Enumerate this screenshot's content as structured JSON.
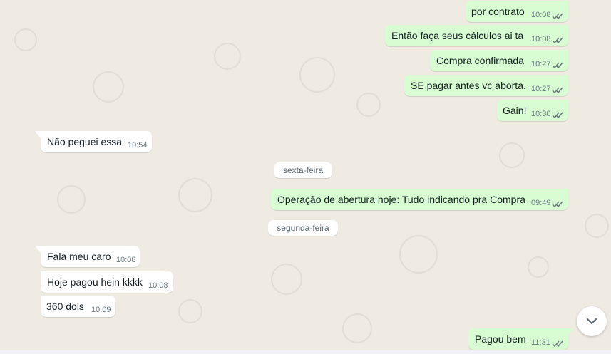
{
  "chat": {
    "background_color": "#efeae2",
    "outgoing_bubble_color": "#d9fdd3",
    "incoming_bubble_color": "#ffffff",
    "read_tick_color": "#53bdeb",
    "messages": [
      {
        "direction": "out",
        "text": "por contrato",
        "time": "10:08",
        "status": "read"
      },
      {
        "direction": "out",
        "text": "Então faça seus cálculos ai ta",
        "time": "10:08",
        "status": "read"
      },
      {
        "direction": "out",
        "text": "Compra confirmada",
        "time": "10:27",
        "status": "read"
      },
      {
        "direction": "out",
        "text": "SE pagar antes vc aborta.",
        "time": "10:27",
        "status": "read"
      },
      {
        "direction": "out",
        "text": "Gain!",
        "time": "10:30",
        "status": "read"
      },
      {
        "direction": "in",
        "text": "Não peguei essa",
        "time": "10:54"
      },
      {
        "direction": "out",
        "text": "Operação de abertura hoje: Tudo indicando pra Compra",
        "time": "09:49",
        "status": "read"
      },
      {
        "direction": "in",
        "text": "Fala meu caro",
        "time": "10:08"
      },
      {
        "direction": "in",
        "text": "Hoje pagou hein kkkk",
        "time": "10:08"
      },
      {
        "direction": "in",
        "text": "360 dols",
        "time": "10:09"
      },
      {
        "direction": "out",
        "text": "Pagou bem",
        "time": "11:31",
        "status": "read"
      }
    ],
    "day_separators": [
      {
        "label": "sexta-feira"
      },
      {
        "label": "segunda-feira"
      }
    ],
    "scroll_button_icon": "chevron-down-icon"
  }
}
